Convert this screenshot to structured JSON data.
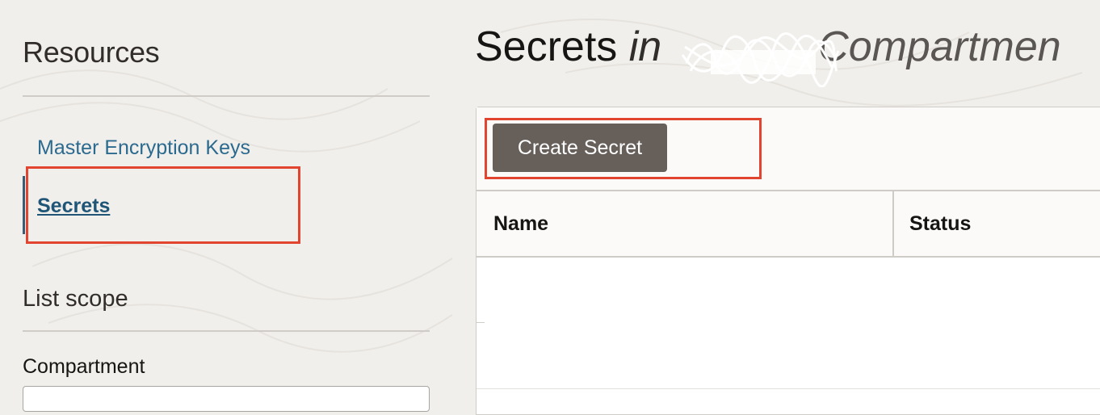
{
  "sidebar": {
    "resources_title": "Resources",
    "items": [
      {
        "label": "Master Encryption Keys",
        "active": false
      },
      {
        "label": "Secrets",
        "active": true
      }
    ],
    "list_scope_title": "List scope",
    "compartment_label": "Compartment"
  },
  "header": {
    "title_main": "Secrets",
    "title_in": "in",
    "title_compartment_word": "Compartmen"
  },
  "toolbar": {
    "create_label": "Create Secret"
  },
  "table": {
    "columns": [
      "Name",
      "Status"
    ],
    "rows": []
  },
  "colors": {
    "highlight": "#e2452f",
    "link": "#2b6a8f",
    "button_bg": "#665f5a",
    "page_bg": "#f1efeb"
  }
}
